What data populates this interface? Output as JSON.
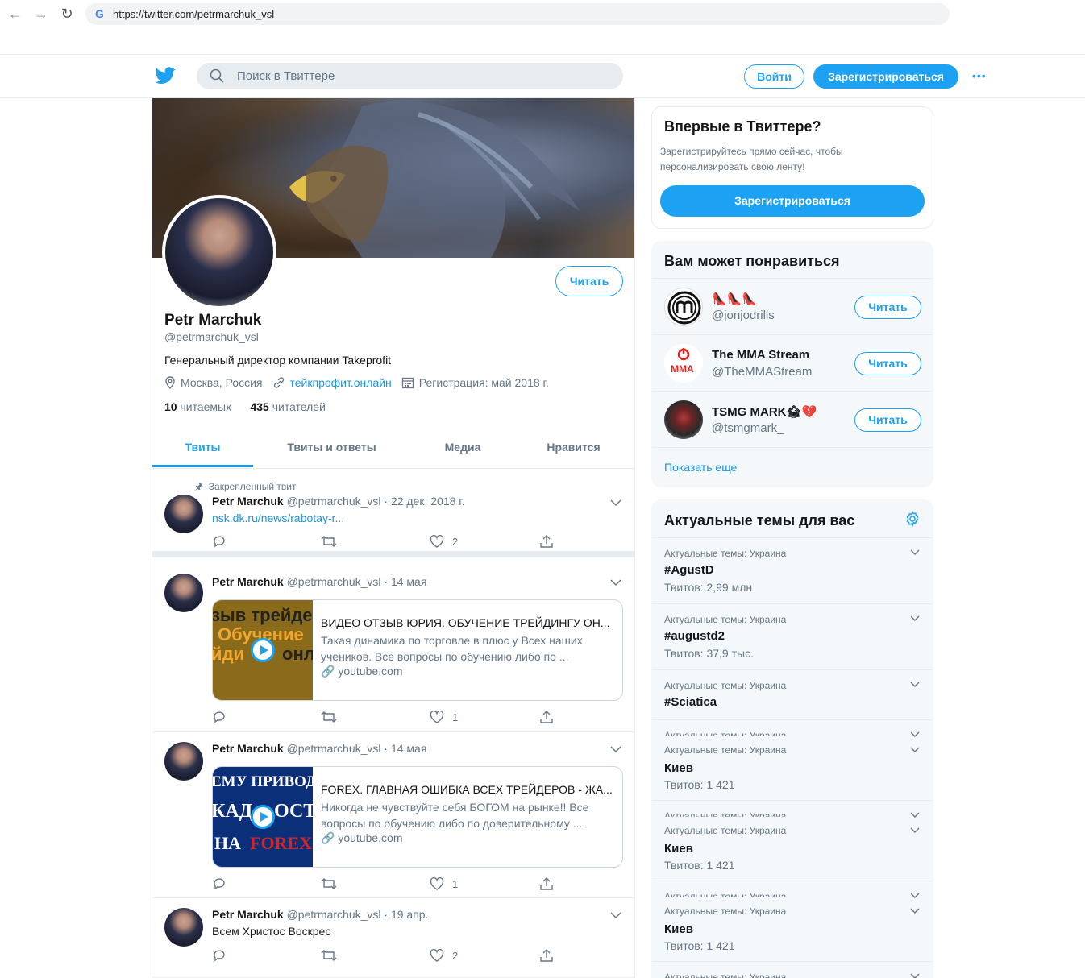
{
  "browser": {
    "url": "https://twitter.com/petrmarchuk_vsl"
  },
  "header": {
    "search_placeholder": "Поиск в Твиттере",
    "login_label": "Войти",
    "signup_label": "Зарегистрироваться",
    "more_label": "•••"
  },
  "profile": {
    "follow_label": "Читать",
    "name": "Petr Marchuk",
    "handle": "@petrmarchuk_vsl",
    "bio": "Генеральный директор компании Takeprofit",
    "location": "Москва, Россия",
    "website": "тейкпрофит.онлайн",
    "joined": "Регистрация: май 2018 г.",
    "following_count": "10",
    "following_label": "читаемых",
    "followers_count": "435",
    "followers_label": "читателей",
    "tabs": [
      "Твиты",
      "Твиты и ответы",
      "Медиа",
      "Нравится"
    ]
  },
  "tweets": [
    {
      "pinned_label": "Закрепленный твит",
      "name": "Petr Marchuk",
      "meta": "@petrmarchuk_vsl · 22 дек. 2018 г.",
      "link": "nsk.dk.ru/news/rabotay-r...",
      "likes": "2"
    },
    {
      "name": "Petr Marchuk",
      "meta": "@petrmarchuk_vsl · 14 мая",
      "card_img_lines": [
        "зыв трейде",
        "Обучение",
        "йди",
        "онл"
      ],
      "card_title": "ВИДЕО ОТЗЫВ ЮРИЯ. ОБУЧЕНИЕ ТРЕЙДИНГУ ОН...",
      "card_desc": "Такая динамика по торговле в плюс у Всех наших учеников. Все вопросы по обучению либо по ...",
      "card_domain": "youtube.com",
      "likes": "1"
    },
    {
      "name": "Petr Marchuk",
      "meta": "@petrmarchuk_vsl · 14 мая",
      "card_img_lines": [
        "ЕМУ ПРИВОД",
        "КАД",
        "ОСТЬ",
        "НА",
        "FOREX"
      ],
      "card_title": "FOREX. ГЛАВНАЯ ОШИБКА ВСЕХ ТРЕЙДЕРОВ - ЖА...",
      "card_desc": "Никогда не чувствуйте себя БОГОМ на рынке!! Все вопросы по обучению либо по доверительному ...",
      "card_domain": "youtube.com",
      "likes": "1"
    },
    {
      "name": "Petr Marchuk",
      "meta": "@petrmarchuk_vsl · 19 апр.",
      "text": "Всем Христос Воскрес",
      "likes": "2"
    }
  ],
  "signup_box": {
    "title": "Впервые в Твиттере?",
    "subtitle": "Зарегистрируйтесь прямо сейчас, чтобы персонализировать свою ленту!",
    "button": "Зарегистрироваться"
  },
  "suggestions": {
    "title": "Вам может понравиться",
    "follow_label": "Читать",
    "items": [
      {
        "name": "👠👠👠",
        "handle": "@jonjodrills"
      },
      {
        "name": "The MMA Stream",
        "handle": "@TheMMAStream",
        "logo_text": "MMA"
      },
      {
        "name": "TSMG MARK🏚💔",
        "handle": "@tsmgmark_"
      }
    ],
    "show_more": "Показать еще"
  },
  "trends": {
    "title": "Актуальные темы для вас",
    "items": [
      {
        "category": "Актуальные темы: Украина",
        "name": "#AgustD",
        "count": "Твитов: 2,99 млн"
      },
      {
        "category": "Актуальные темы: Украина",
        "name": "#augustd2",
        "count": "Твитов: 37,9 тыс."
      },
      {
        "category": "Актуальные темы: Украина",
        "name": "#Sciatica",
        "count": ""
      },
      {
        "category": "Актуальные темы: Украина",
        "name": "Киев",
        "count": "Твитов: 1 421"
      },
      {
        "category": "Актуальные темы: Украина",
        "name": "Киев",
        "count": "Твитов: 1 421"
      },
      {
        "category": "Актуальные темы: Украина",
        "name": "Киев",
        "count": "Твитов: 1 421"
      },
      {
        "category": "Актуальные темы: Украина",
        "name": "",
        "count": ""
      }
    ]
  },
  "colors": {
    "accent": "#1da1f2",
    "link": "#1b95e0",
    "muted": "#657786",
    "border": "#e6ecf0"
  }
}
